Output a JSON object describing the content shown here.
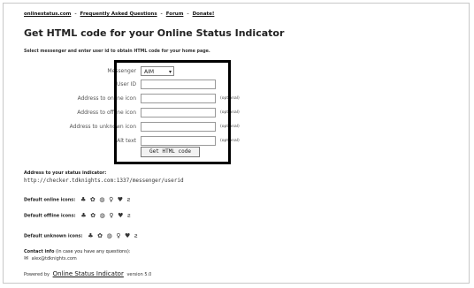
{
  "nav": {
    "links": [
      "onlinestatus.com",
      "Frequently Asked Questions",
      "Forum",
      "Donate!"
    ],
    "separator": "-"
  },
  "page": {
    "title": "Get HTML code for your Online Status Indicator",
    "subtitle": "Select messenger and enter user id to obtain HTML code for your home page."
  },
  "form": {
    "messenger_label": "Messenger",
    "messenger_value": "AIM",
    "userid_label": "User ID",
    "online_label": "Address to online icon",
    "offline_label": "Address to offline icon",
    "unknown_label": "Address to unknown icon",
    "alt_label": "Alt text",
    "optional_note": "(optional)",
    "button_label": "Get HTML code"
  },
  "address": {
    "label": "Address to your status indicator:",
    "url": "http://checker.tdknights.com:1337/messenger/userid"
  },
  "icon_rows": {
    "online_label": "Default online icons:",
    "offline_label": "Default offline icons:",
    "unknown_label": "Default unknown icons:"
  },
  "contact": {
    "label": "Contact info",
    "note": "(in case you have any questions):",
    "email": "alex@tdknights.com"
  },
  "footer": {
    "prefix": "Powered by",
    "link": "Online Status Indicator",
    "suffix": "version 5.0"
  }
}
